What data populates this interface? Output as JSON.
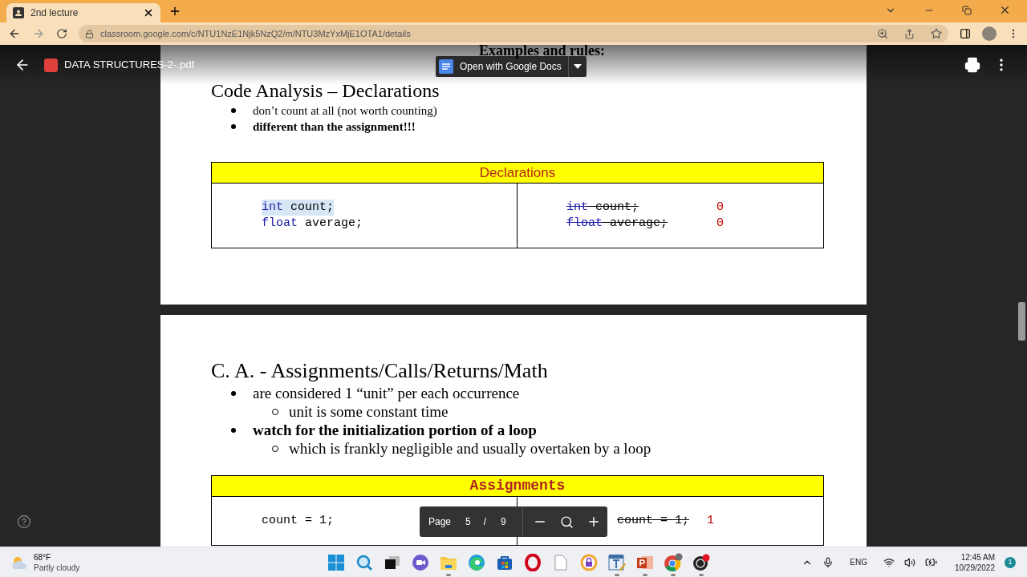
{
  "browser": {
    "tabs": [
      {
        "title": "2nd lecture",
        "selected": true
      }
    ],
    "url": "classroom.google.com/c/NTU1NzE1Njk5NzQ2/m/NTU3MzYxMjE1OTA1/details"
  },
  "viewer": {
    "file_name": "DATA STRUCTURES-2-.pdf",
    "open_button": "Open with Google Docs"
  },
  "pages": [
    {
      "heading_tail": "Examples and rules:",
      "title": "Code Analysis – Declarations",
      "bullets": [
        {
          "text": "don’t count at all (not worth counting)",
          "bold": false
        },
        {
          "text": "different than the assignment!!!",
          "bold": true
        }
      ],
      "table": {
        "title": "Declarations",
        "kind": "sans",
        "left": [
          {
            "tokens": [
              {
                "kind": "keyword",
                "text": "int"
              },
              {
                "kind": "plain",
                "text": " count;"
              }
            ],
            "highlighted": true
          },
          {
            "tokens": [
              {
                "kind": "keyword",
                "text": "float"
              },
              {
                "kind": "plain",
                "text": " average;"
              }
            ],
            "highlighted": false
          }
        ],
        "right": [
          {
            "tokens": [
              {
                "kind": "keyword",
                "text": "int"
              },
              {
                "kind": "plain",
                "text": " count;"
              }
            ],
            "struck": true,
            "count": "0"
          },
          {
            "tokens": [
              {
                "kind": "keyword",
                "text": "float"
              },
              {
                "kind": "plain",
                "text": " average;"
              }
            ],
            "struck": true,
            "count": "0"
          }
        ]
      }
    },
    {
      "title": "C. A. - Assignments/Calls/Returns/Math",
      "bullets": [
        {
          "text": "are considered 1 “unit” per each occurrence",
          "bold": false,
          "children": [
            {
              "text": "unit is some constant time"
            }
          ]
        },
        {
          "text": "watch for the initialization portion of a loop",
          "bold": true,
          "children": [
            {
              "text": "which is frankly negligible and usually overtaken by a loop"
            }
          ]
        }
      ],
      "table": {
        "title": "Assignments",
        "kind": "mono",
        "left": [
          {
            "tokens": [
              {
                "kind": "plain",
                "text": "count = 1;"
              }
            ],
            "highlighted": false
          }
        ],
        "right": [
          {
            "tokens": [
              {
                "kind": "plain",
                "text": "count = 1;"
              }
            ],
            "struck": true,
            "count": "1"
          }
        ]
      }
    }
  ],
  "page_control": {
    "label": "Page",
    "current": "5",
    "separator": "/",
    "total": "9"
  },
  "taskbar": {
    "temperature": "68°F",
    "weather": "Partly cloudy",
    "apps": [
      {
        "kind": "start",
        "running": false
      },
      {
        "kind": "search",
        "running": false
      },
      {
        "kind": "taskview",
        "running": false
      },
      {
        "kind": "chat",
        "running": false
      },
      {
        "kind": "files",
        "running": true
      },
      {
        "kind": "edge",
        "running": false
      },
      {
        "kind": "store",
        "running": false
      },
      {
        "kind": "opera",
        "running": false
      },
      {
        "kind": "document",
        "running": false
      },
      {
        "kind": "avast",
        "running": false
      },
      {
        "kind": "editor",
        "running": true
      },
      {
        "kind": "powerpoint",
        "running": true
      },
      {
        "kind": "chrome",
        "running": true
      },
      {
        "kind": "obs",
        "running": true
      }
    ],
    "language": "ENG",
    "time": "12:45 AM",
    "date": "10/29/2022",
    "notifications": "1"
  }
}
